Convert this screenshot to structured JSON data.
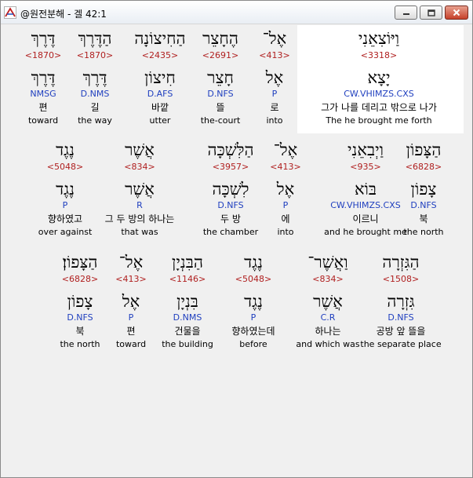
{
  "window": {
    "title": "@원전분해 - 겔 42:1",
    "icon": "interlinear-app-icon",
    "controls": [
      "minimize-icon",
      "maximize-icon",
      "close-icon"
    ]
  },
  "colors": {
    "strong": "#b02020",
    "morph": "#1f3fbf",
    "highlight": "#ffffff"
  },
  "rows": [
    {
      "words": [
        {
          "heb": "וַיּוֹצִאֵנִי",
          "strong": "<3318>",
          "lex": "יָצָא",
          "morph": "CW.VHIMZS.CXS",
          "ko": "그가 나를 데리고 밖으로 나가",
          "en": "The he brought me forth",
          "highlighted": true
        },
        {
          "heb": "אֶל־",
          "strong": "<413>",
          "lex": "אֶל",
          "morph": "P",
          "ko": "로",
          "en": "into"
        },
        {
          "heb": "הֶחָצֵר",
          "strong": "<2691>",
          "lex": "חָצֵר",
          "morph": "D.NFS",
          "ko": "뜰",
          "en": "the-court"
        },
        {
          "heb": "הַחִיצוֹנָה",
          "strong": "<2435>",
          "lex": "חִיצוֹן",
          "morph": "D.AFS",
          "ko": "바깥",
          "en": "utter"
        },
        {
          "heb": "הַדֶּרֶךְ",
          "strong": "<1870>",
          "lex": "דֶּרֶךְ",
          "morph": "D.NMS",
          "ko": "길",
          "en": "the way"
        },
        {
          "heb": "דֶּרֶךְ",
          "strong": "<1870>",
          "lex": "דֶּרֶךְ",
          "morph": "NMSG",
          "ko": "편",
          "en": "toward"
        }
      ]
    },
    {
      "words": [
        {
          "heb": "הַצָּפוֹן",
          "strong": "<6828>",
          "lex": "צָפוֹן",
          "morph": "D.NFS",
          "ko": "북",
          "en": "the north"
        },
        {
          "heb": "וַיְבִאֵנִי",
          "strong": "<935>",
          "lex": "בּוֹא",
          "morph": "CW.VHIMZS.CXS",
          "ko": "이르니",
          "en": "and he brought me"
        },
        {
          "heb": "אֶל־",
          "strong": "<413>",
          "lex": "אֶל",
          "morph": "P",
          "ko": "에",
          "en": "into"
        },
        {
          "heb": "הַלִּשְׁכָּה",
          "strong": "<3957>",
          "lex": "לִשְׁכָּה",
          "morph": "D.NFS",
          "ko": "두 방",
          "en": "the chamber"
        },
        {
          "heb": "אֲשֶׁר",
          "strong": "<834>",
          "lex": "אֲשֶׁר",
          "morph": "R",
          "ko": "그 두 방의 하나는",
          "en": "that was"
        },
        {
          "heb": "נֶגֶד",
          "strong": "<5048>",
          "lex": "נֶגֶד",
          "morph": "P",
          "ko": "향하였고",
          "en": "over against"
        }
      ]
    },
    {
      "words": [
        {
          "heb": "הַגִּזְרָה",
          "strong": "<1508>",
          "lex": "גִּזְרָה",
          "morph": "D.NFS",
          "ko": "공방 앞 뜰을",
          "en": "the separate place"
        },
        {
          "heb": "וַאֲשֶׁר־",
          "strong": "<834>",
          "lex": "אֲשֶׁר",
          "morph": "C.R",
          "ko": "하나는",
          "en": "and which was"
        },
        {
          "heb": "נֶגֶד",
          "strong": "<5048>",
          "lex": "נֶגֶד",
          "morph": "P",
          "ko": "향하였는데",
          "en": "before"
        },
        {
          "heb": "הַבִּנְיָן",
          "strong": "<1146>",
          "lex": "בִּנְיָן",
          "morph": "D.NMS",
          "ko": "건물을",
          "en": "the building"
        },
        {
          "heb": "אֶל־",
          "strong": "<413>",
          "lex": "אֶל",
          "morph": "P",
          "ko": "편",
          "en": "toward"
        },
        {
          "heb": "הַצָּפוֹן׃",
          "strong": "<6828>",
          "lex": "צָפוֹן",
          "morph": "D.NFS",
          "ko": "북",
          "en": "the north"
        }
      ]
    }
  ]
}
